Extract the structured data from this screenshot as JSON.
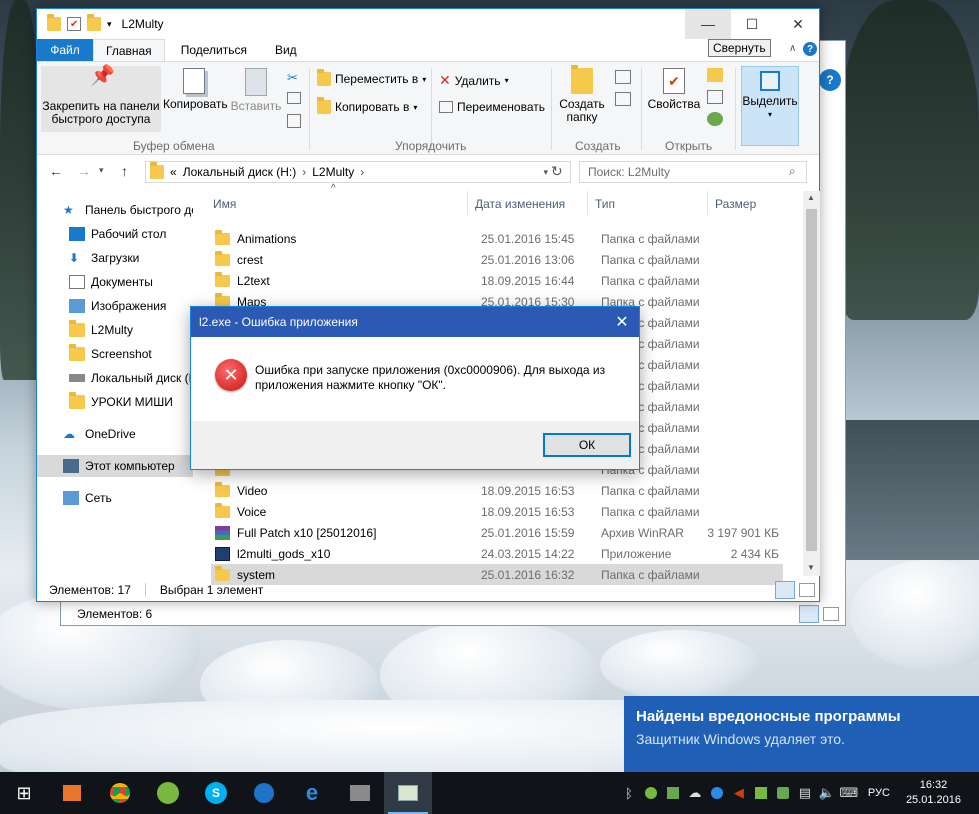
{
  "explorer": {
    "title": "L2Multy",
    "tooltip": "Свернуть",
    "tabs": {
      "file": "Файл",
      "home": "Главная",
      "share": "Поделиться",
      "view": "Вид"
    },
    "ribbon": {
      "pin": "Закрепить на панели быстрого доступа",
      "copy": "Копировать",
      "paste": "Вставить",
      "move_to": "Переместить в",
      "copy_to": "Копировать в",
      "delete": "Удалить",
      "rename": "Переименовать",
      "new_folder": "Создать папку",
      "properties": "Свойства",
      "select": "Выделить",
      "groups": {
        "clipboard": "Буфер обмена",
        "organize": "Упорядочить",
        "create": "Создать",
        "open": "Открыть"
      }
    },
    "address": {
      "prefix": "«",
      "drive": "Локальный диск (H:)",
      "folder": "L2Multy"
    },
    "search_placeholder": "Поиск: L2Multy",
    "nav": [
      {
        "label": "Панель быстрого доступа"
      },
      {
        "label": "Рабочий стол"
      },
      {
        "label": "Загрузки"
      },
      {
        "label": "Документы"
      },
      {
        "label": "Изображения"
      },
      {
        "label": "L2Multy"
      },
      {
        "label": "Screenshot"
      },
      {
        "label": "Локальный диск (H"
      },
      {
        "label": "УРОКИ МИШИ"
      },
      {
        "label": "OneDrive"
      },
      {
        "label": "Этот компьютер"
      },
      {
        "label": "Сеть"
      }
    ],
    "columns": {
      "name": "Имя",
      "date": "Дата изменения",
      "type": "Тип",
      "size": "Размер"
    },
    "files": [
      {
        "name": "Animations",
        "date": "25.01.2016 15:45",
        "type": "Папка с файлами",
        "size": ""
      },
      {
        "name": "crest",
        "date": "25.01.2016 13:06",
        "type": "Папка с файлами",
        "size": ""
      },
      {
        "name": "L2text",
        "date": "18.09.2015 16:44",
        "type": "Папка с файлами",
        "size": ""
      },
      {
        "name": "Maps",
        "date": "25.01.2016 15:30",
        "type": "Папка с файлами",
        "size": ""
      },
      {
        "name": "",
        "date": "",
        "type": "Папка с файлами",
        "size": ""
      },
      {
        "name": "",
        "date": "",
        "type": "Папка с файлами",
        "size": ""
      },
      {
        "name": "",
        "date": "",
        "type": "Папка с файлами",
        "size": ""
      },
      {
        "name": "",
        "date": "",
        "type": "Папка с файлами",
        "size": ""
      },
      {
        "name": "",
        "date": "",
        "type": "Папка с файлами",
        "size": ""
      },
      {
        "name": "",
        "date": "",
        "type": "Папка с файлами",
        "size": ""
      },
      {
        "name": "",
        "date": "",
        "type": "Папка с файлами",
        "size": ""
      },
      {
        "name": "",
        "date": "",
        "type": "Папка с файлами",
        "size": ""
      },
      {
        "name": "Video",
        "date": "18.09.2015 16:53",
        "type": "Папка с файлами",
        "size": ""
      },
      {
        "name": "Voice",
        "date": "18.09.2015 16:53",
        "type": "Папка с файлами",
        "size": ""
      },
      {
        "name": "Full Patch x10 [25012016]",
        "date": "25.01.2016 15:59",
        "type": "Архив WinRAR",
        "size": "3 197 901 КБ"
      },
      {
        "name": "l2multi_gods_x10",
        "date": "24.03.2015 14:22",
        "type": "Приложение",
        "size": "2 434 КБ"
      },
      {
        "name": "system",
        "date": "25.01.2016 16:32",
        "type": "Папка с файлами",
        "size": ""
      }
    ],
    "status": {
      "count": "Элементов: 17",
      "selected": "Выбран 1 элемент"
    }
  },
  "back_window": {
    "status": "Элементов: 6"
  },
  "dialog": {
    "title": "l2.exe - Ошибка приложения",
    "message": "Ошибка при запуске приложения (0xc0000906). Для выхода из приложения нажмите кнопку \"ОК\".",
    "ok": "ОК"
  },
  "toast": {
    "title": "Найдены вредоносные программы",
    "body": "Защитник Windows удаляет это."
  },
  "taskbar": {
    "lang": "РУС",
    "time": "16:32",
    "date": "25.01.2016"
  }
}
